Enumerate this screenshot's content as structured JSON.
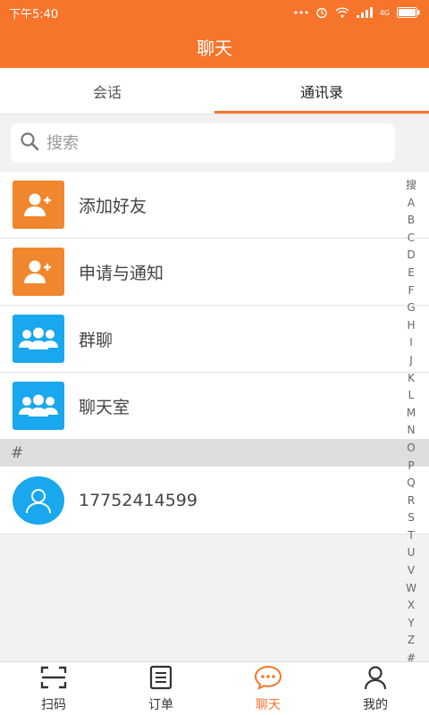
{
  "status_bar": {
    "time": "下午5:40",
    "network": "4G"
  },
  "header": {
    "title": "聊天"
  },
  "tabs": [
    {
      "label": "会话",
      "active": false
    },
    {
      "label": "通讯录",
      "active": true
    }
  ],
  "search": {
    "placeholder": "搜索"
  },
  "menu_items": [
    {
      "label": "添加好友",
      "icon": "add-user-icon",
      "color": "#f0862d"
    },
    {
      "label": "申请与通知",
      "icon": "add-user-icon",
      "color": "#f0862d"
    },
    {
      "label": "群聊",
      "icon": "group-icon",
      "color": "#19a7ee"
    },
    {
      "label": "聊天室",
      "icon": "group-icon",
      "color": "#19a7ee"
    }
  ],
  "section": {
    "header": "#"
  },
  "contacts": [
    {
      "name": "17752414599",
      "icon": "user-avatar-icon"
    }
  ],
  "index_letters": [
    "搜",
    "A",
    "B",
    "C",
    "D",
    "E",
    "F",
    "G",
    "H",
    "I",
    "J",
    "K",
    "L",
    "M",
    "N",
    "O",
    "P",
    "Q",
    "R",
    "S",
    "T",
    "U",
    "V",
    "W",
    "X",
    "Y",
    "Z",
    "#"
  ],
  "bottom_nav": [
    {
      "label": "扫码",
      "icon": "scan-icon",
      "active": false
    },
    {
      "label": "订单",
      "icon": "order-icon",
      "active": false
    },
    {
      "label": "聊天",
      "icon": "chat-icon",
      "active": true
    },
    {
      "label": "我的",
      "icon": "profile-icon",
      "active": false
    }
  ],
  "colors": {
    "accent": "#f7742b",
    "orange_icon": "#f0862d",
    "blue_icon": "#19a7ee"
  }
}
